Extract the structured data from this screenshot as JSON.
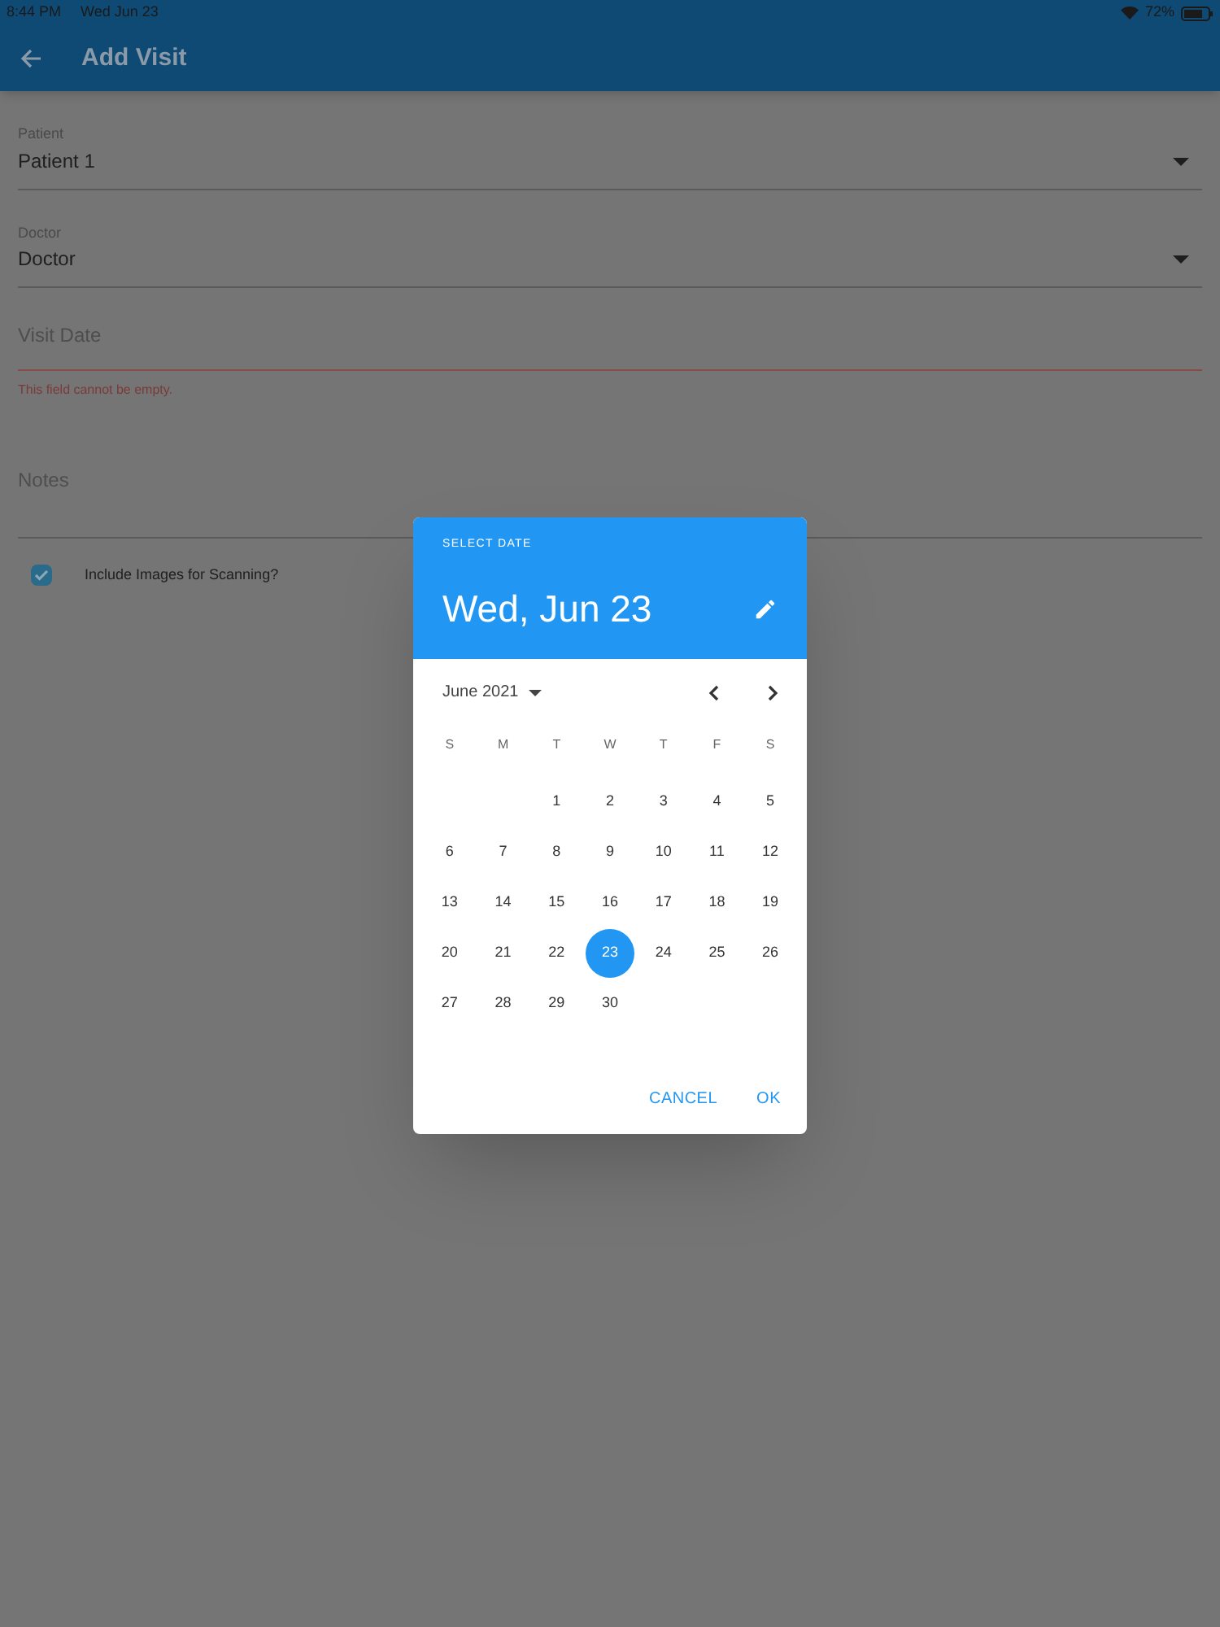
{
  "status_bar": {
    "time": "8:44 PM",
    "date": "Wed Jun 23",
    "battery": "72%"
  },
  "app_bar": {
    "title": "Add Visit"
  },
  "form": {
    "fields": [
      {
        "kind": "dropdown",
        "label": "Patient",
        "value": "Patient 1"
      },
      {
        "kind": "dropdown",
        "label": "Doctor",
        "value": "Doctor"
      },
      {
        "kind": "text",
        "placeholder": "Visit Date",
        "error": "This field cannot be empty."
      },
      {
        "kind": "multiline",
        "placeholder": "Notes"
      }
    ],
    "checkbox": {
      "label": "Include Images for Scanning?",
      "checked": true
    }
  },
  "date_picker": {
    "caption": "SELECT DATE",
    "headline": "Wed, Jun 23",
    "month": "June 2021",
    "weekdays": [
      "S",
      "M",
      "T",
      "W",
      "T",
      "F",
      "S"
    ],
    "weeks": [
      {
        "days": [
          {
            "day": "1",
            "selected": false
          },
          {
            "day": "2",
            "selected": false
          },
          {
            "day": "3",
            "selected": false
          },
          {
            "day": "4",
            "selected": false
          },
          {
            "day": "5",
            "selected": false
          }
        ]
      },
      {
        "days": [
          {
            "day": "6",
            "selected": false
          },
          {
            "day": "7",
            "selected": false
          },
          {
            "day": "8",
            "selected": false
          },
          {
            "day": "9",
            "selected": false
          },
          {
            "day": "10",
            "selected": false
          },
          {
            "day": "11",
            "selected": false
          },
          {
            "day": "12",
            "selected": false
          }
        ]
      },
      {
        "days": [
          {
            "day": "13",
            "selected": false
          },
          {
            "day": "14",
            "selected": false
          },
          {
            "day": "15",
            "selected": false
          },
          {
            "day": "16",
            "selected": false
          },
          {
            "day": "17",
            "selected": false
          },
          {
            "day": "18",
            "selected": false
          },
          {
            "day": "19",
            "selected": false
          }
        ]
      },
      {
        "days": [
          {
            "day": "20",
            "selected": false
          },
          {
            "day": "21",
            "selected": false
          },
          {
            "day": "22",
            "selected": false
          },
          {
            "day": "23",
            "selected": true
          },
          {
            "day": "24",
            "selected": false
          },
          {
            "day": "25",
            "selected": false
          },
          {
            "day": "26",
            "selected": false
          }
        ]
      },
      {
        "days": [
          {
            "day": "27",
            "selected": false
          },
          {
            "day": "28",
            "selected": false
          },
          {
            "day": "29",
            "selected": false
          },
          {
            "day": "30",
            "selected": false
          }
        ]
      }
    ],
    "buttons": [
      "CANCEL",
      "OK"
    ]
  }
}
